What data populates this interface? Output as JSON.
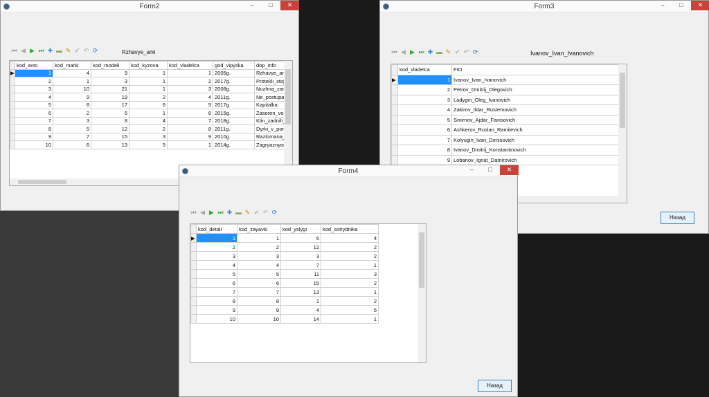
{
  "toolbar_icons": [
    "first-icon",
    "prior-icon",
    "next-icon",
    "last-icon",
    "insert-icon",
    "delete-icon",
    "edit-icon",
    "post-icon",
    "cancel-icon",
    "refresh-icon"
  ],
  "form2": {
    "title": "Form2",
    "label": "Rzhavye_arki",
    "columns": [
      "kod_avto",
      "kod_marki",
      "kod_modeli",
      "kod_kyzova",
      "kod_vladelca",
      "god_vipyska",
      "dop_info"
    ],
    "rows": [
      [
        "1",
        "4",
        "9",
        "1",
        "1",
        "2005g.",
        "Rzhavye_arki"
      ],
      [
        "2",
        "1",
        "3",
        "1",
        "2",
        "2017g.",
        "Protekli_stojk"
      ],
      [
        "3",
        "10",
        "21",
        "1",
        "3",
        "2008g.",
        "Nuzhna_zam"
      ],
      [
        "4",
        "9",
        "19",
        "2",
        "4",
        "2011g.",
        "Ne_postupae"
      ],
      [
        "5",
        "8",
        "17",
        "6",
        "5",
        "2017g.",
        "Kapitalka"
      ],
      [
        "6",
        "2",
        "5",
        "1",
        "6",
        "2015g.",
        "Zasoren_vozd"
      ],
      [
        "7",
        "3",
        "8",
        "4",
        "7",
        "2018g.",
        "Klin_zadnih_t"
      ],
      [
        "8",
        "5",
        "12",
        "2",
        "8",
        "2011g.",
        "Dyrki_v_poro"
      ],
      [
        "9",
        "7",
        "15",
        "3",
        "9",
        "2010g.",
        "Razlomana_k"
      ],
      [
        "10",
        "6",
        "13",
        "5",
        "1",
        "2014g.",
        "Zagryaznyon"
      ]
    ]
  },
  "form3": {
    "title": "Form3",
    "label": "Ivanov_Ivan_Ivanovich",
    "back_button": "Назад",
    "columns": [
      "kod_vladelca",
      "FIO"
    ],
    "rows": [
      [
        "1",
        "Ivanov_Ivan_Ivanovich"
      ],
      [
        "2",
        "Petrov_Dmitrij_Olegovich"
      ],
      [
        "3",
        "Ladygin_Oleg_Ivanovich"
      ],
      [
        "4",
        "Zakirov_Ildar_Rustemovich"
      ],
      [
        "5",
        "Smirnov_Ajdar_Fanisovich"
      ],
      [
        "6",
        "Ashkerov_Ruslan_Ramilevich"
      ],
      [
        "7",
        "Kolyugin_Ivan_Denisovich"
      ],
      [
        "8",
        "Ivanov_Dmitrij_Konstantinovich"
      ],
      [
        "9",
        "Lobanov_Ignat_Damirovich"
      ]
    ]
  },
  "form4": {
    "title": "Form4",
    "back_button": "Назад",
    "columns": [
      "kod_detali",
      "kod_zayavki",
      "kod_yslygi",
      "kod_sotrydnika"
    ],
    "rows": [
      [
        "1",
        "1",
        "6",
        "4"
      ],
      [
        "2",
        "2",
        "12",
        "2"
      ],
      [
        "3",
        "3",
        "3",
        "2"
      ],
      [
        "4",
        "4",
        "7",
        "1"
      ],
      [
        "5",
        "5",
        "11",
        "3"
      ],
      [
        "6",
        "6",
        "15",
        "2"
      ],
      [
        "7",
        "7",
        "13",
        "1"
      ],
      [
        "8",
        "8",
        "1",
        "2"
      ],
      [
        "9",
        "9",
        "4",
        "5"
      ],
      [
        "10",
        "10",
        "14",
        "1"
      ]
    ]
  }
}
